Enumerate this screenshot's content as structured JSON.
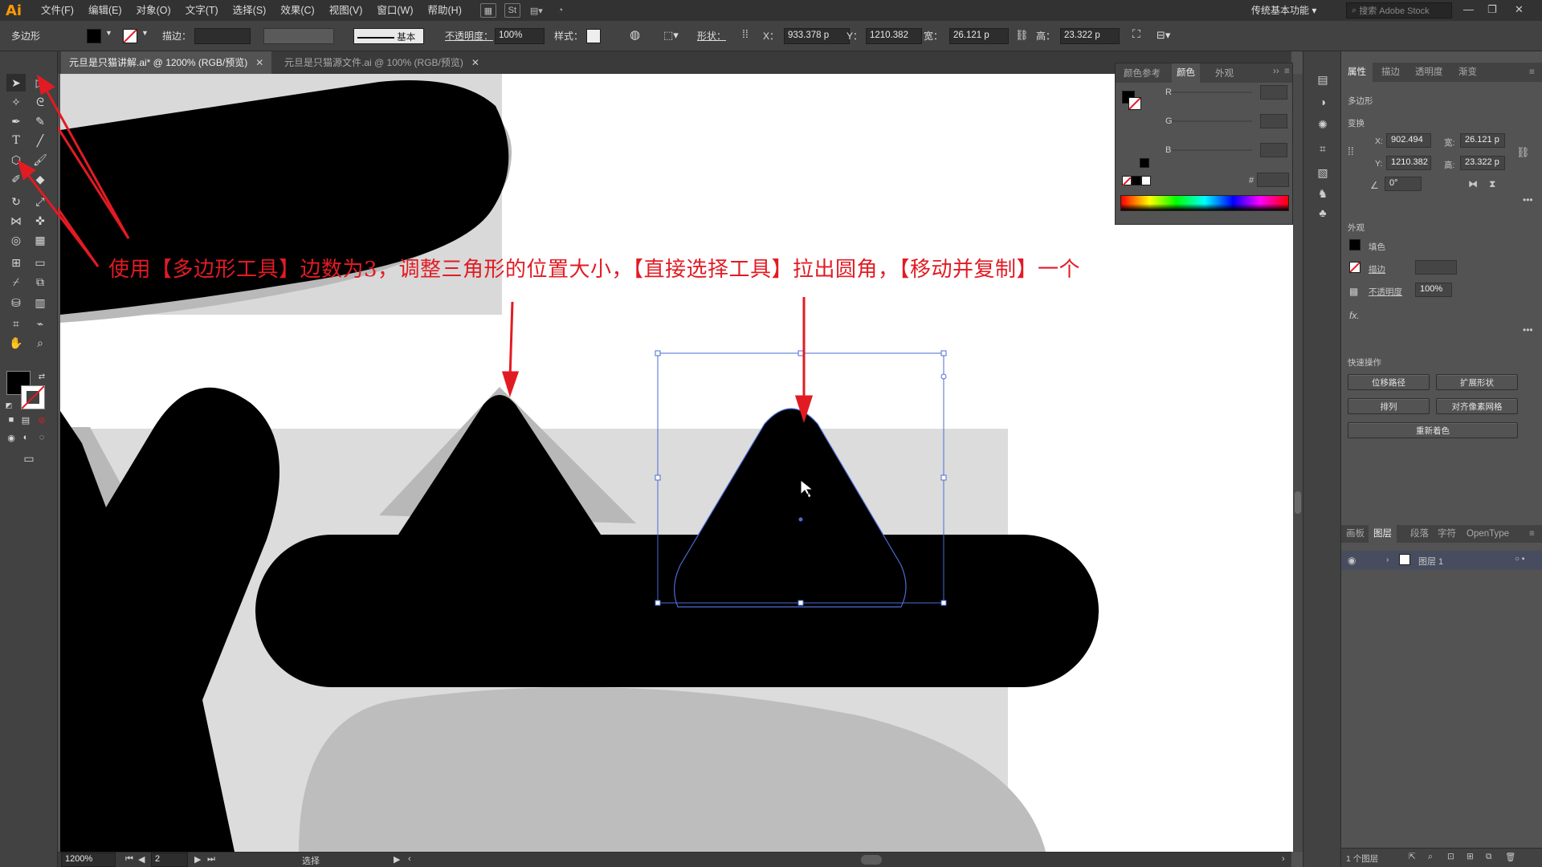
{
  "app": {
    "logo": "Ai",
    "menu": [
      "文件(F)",
      "编辑(E)",
      "对象(O)",
      "文字(T)",
      "选择(S)",
      "效果(C)",
      "视图(V)",
      "窗口(W)",
      "帮助(H)"
    ],
    "menu_icons": [
      "St"
    ],
    "workspace": "传统基本功能",
    "stock_search_placeholder": "搜索 Adobe Stock"
  },
  "control_bar": {
    "tool_name": "多边形",
    "stroke_label": "描边：",
    "stroke_profile": "基本",
    "opacity_label": "不透明度：",
    "opacity_value": "100%",
    "style_label": "样式：",
    "shape_label": "形状：",
    "x_label": "X：",
    "x_value": "933.378",
    "x_unit": "p",
    "y_label": "Y：",
    "y_value": "1210.382",
    "w_label": "宽：",
    "w_value": "26.121",
    "w_unit": "p",
    "h_label": "高：",
    "h_value": "23.322",
    "h_unit": "p"
  },
  "tabs": [
    {
      "label": "元旦是只猫讲解.ai* @ 1200% (RGB/预览)",
      "active": true
    },
    {
      "label": "元旦是只猫源文件.ai @ 100% (RGB/预览)",
      "active": false
    }
  ],
  "annotation": "使用【多边形工具】边数为3，调整三角形的位置大小，【直接选择工具】拉出圆角，【移动并复制】一个",
  "annotation_color": "#e21b23",
  "color_panel": {
    "tabs": [
      "颜色参考",
      "颜色",
      "外观"
    ],
    "active_tab": "颜色",
    "channels": [
      "R",
      "G",
      "B"
    ],
    "hex_label": "#"
  },
  "properties": {
    "tabs": [
      "属性",
      "描边",
      "透明度",
      "渐变"
    ],
    "active_tab": "属性",
    "object_type": "多边形",
    "transform_title": "变换",
    "x_label": "X:",
    "x_value": "902.494",
    "y_label": "Y:",
    "y_value": "1210.382",
    "w_label": "宽:",
    "w_value": "26.121 p",
    "h_label": "高:",
    "h_value": "23.322 p",
    "angle_value": "0°",
    "appearance_title": "外观",
    "fill_label": "填色",
    "stroke_label": "描边",
    "opacity_label": "不透明度",
    "opacity_value": "100%",
    "fx_label": "fx.",
    "quick_actions_title": "快速操作",
    "buttons": [
      "位移路径",
      "扩展形状",
      "排列",
      "对齐像素网格",
      "重新着色"
    ]
  },
  "layers_panel": {
    "tabs": [
      "画板",
      "图层",
      "段落",
      "字符",
      "OpenType"
    ],
    "active_tab": "图层",
    "layer_name": "图层 1",
    "footer_count": "1 个图层"
  },
  "status_bar": {
    "zoom": "1200%",
    "artboard_number": "2",
    "tool_status": "选择"
  },
  "colors": {
    "accent_red": "#e21b23",
    "selection_blue": "#4a6cd4",
    "ui_dark": "#323232",
    "ui_mid": "#424242",
    "ui_panel": "#535353"
  }
}
